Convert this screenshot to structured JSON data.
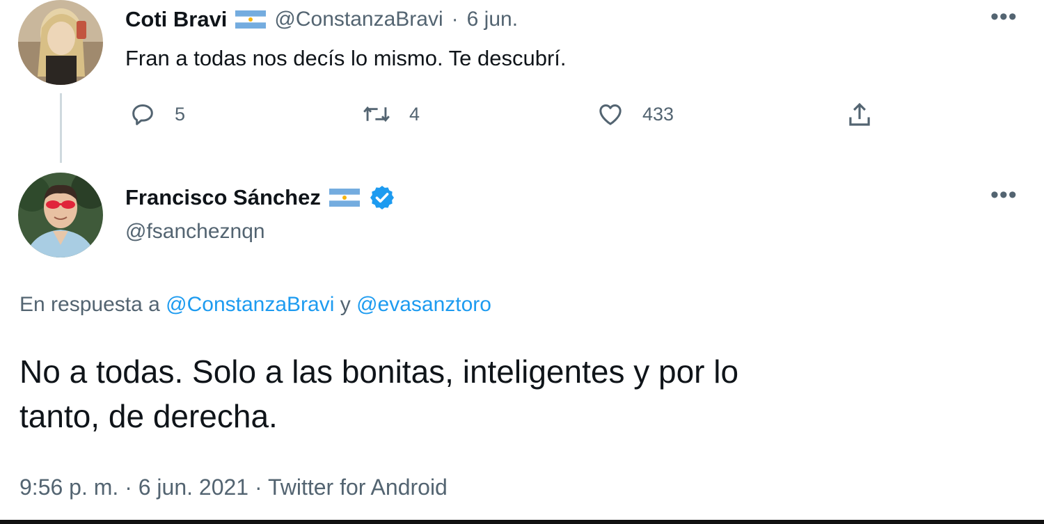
{
  "original_tweet": {
    "author_name": "Coti Bravi",
    "handle": "@ConstanzaBravi",
    "separator": "·",
    "date": "6 jun.",
    "text": "Fran a todas nos decís lo mismo. Te descubrí.",
    "actions": {
      "reply_count": "5",
      "retweet_count": "4",
      "like_count": "433"
    },
    "icons": [
      "reply-icon",
      "retweet-icon",
      "like-icon",
      "share-icon",
      "more-icon",
      "argentina-flag-icon"
    ]
  },
  "reply_tweet": {
    "author_name": "Francisco Sánchez",
    "handle": "@fsancheznqn",
    "verified": true,
    "replying_prefix": "En respuesta a",
    "replying_to_1": "@ConstanzaBravi",
    "replying_conjunction": "y",
    "replying_to_2": "@evasanztoro",
    "text_line_1": "No a todas. Solo a las bonitas, inteligentes y por lo",
    "text_line_2": "tanto, de derecha.",
    "time": "9:56 p. m.",
    "separator_1": "·",
    "date": "6 jun. 2021",
    "separator_2": "·",
    "source": "Twitter for Android",
    "icons": [
      "verified-badge-icon",
      "argentina-flag-icon",
      "more-icon"
    ]
  },
  "colors": {
    "text": "#0f1419",
    "secondary": "#536471",
    "link": "#1d9bf0",
    "verified": "#1d9bf0",
    "flag_blue": "#74acdf",
    "flag_sun": "#f6b40e"
  }
}
